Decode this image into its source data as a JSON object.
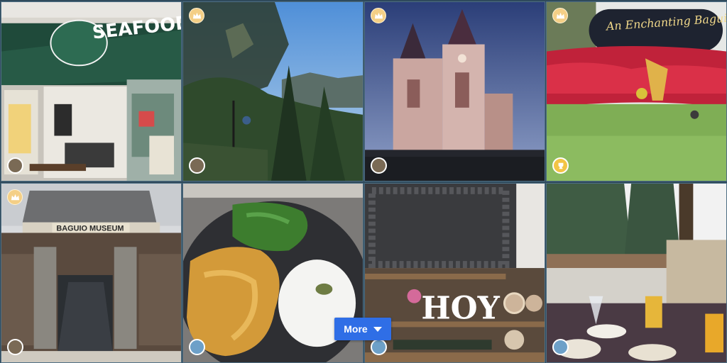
{
  "gallery": {
    "tiles": [
      {
        "name": "Seafood Island storefront",
        "sign_text": "SEAFOOD ISLAND",
        "badge": "crown"
      },
      {
        "name": "Pine trees and mountain view",
        "badge": "crown"
      },
      {
        "name": "Baguio Cathedral at night",
        "badge": "crown"
      },
      {
        "name": "Christmas poinsettia garden",
        "sign_text": "An Enchanting Baguio Christmas",
        "badge": "crown"
      },
      {
        "name": "Baguio Museum",
        "sign_text": "BAGUIO MUSEUM",
        "badge": "crown"
      },
      {
        "name": "Chicken with rice plate"
      },
      {
        "name": "Cafe shelf with HOY letters",
        "sign_text": "HOY"
      },
      {
        "name": "Restaurant table with drinks"
      }
    ],
    "more_button_label": "More"
  },
  "colors": {
    "crown_badge": "#f4cf86",
    "more_button": "#2f6ee6"
  }
}
